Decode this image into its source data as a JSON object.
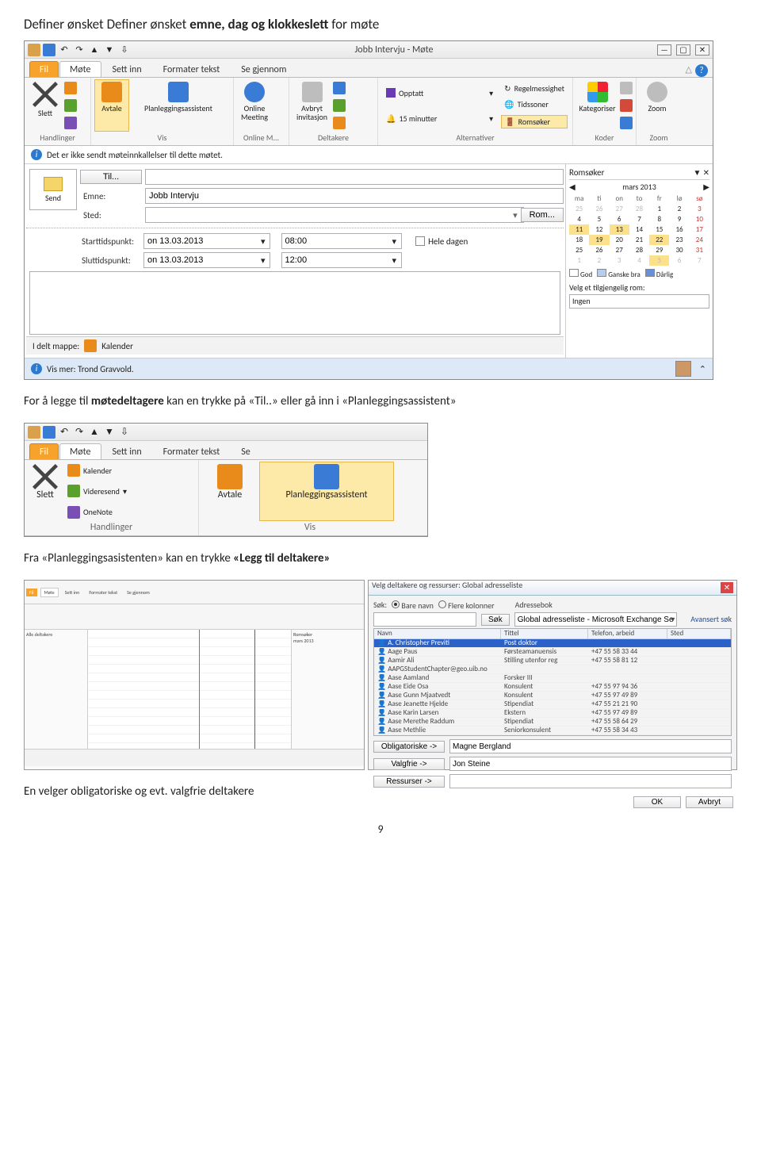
{
  "doc": {
    "heading1": "Definer ønsket emne, dag og klokkeslett for møte",
    "para1": "For å legge til møtedeltagere kan en trykke på «Til..» eller gå inn i «Planleggingsassistent»",
    "para2": "Fra «Planleggingsasistenten» kan en trykke «Legg til deltakere»",
    "para3": "En velger obligatoriske og evt. valgfrie deltakere",
    "page_num": "9"
  },
  "shot1": {
    "title": "Jobb Intervju  -  Møte",
    "tabs": {
      "file": "Fil",
      "mote": "Møte",
      "settinn": "Sett inn",
      "formater": "Formater tekst",
      "segjennom": "Se gjennom"
    },
    "ribbon": {
      "slett": "Slett",
      "handlinger": "Handlinger",
      "avtale": "Avtale",
      "plan": "Planleggingsassistent",
      "vis": "Vis",
      "online1": "Online",
      "online2": "Meeting",
      "online_grp": "Online M...",
      "avbryt1": "Avbryt",
      "avbryt2": "invitasjon",
      "deltakere_grp": "Deltakere",
      "opptatt": "Opptatt",
      "min15": "15 minutter",
      "regel": "Regelmessighet",
      "tidssoner": "Tidssoner",
      "romsoker": "Romsøker",
      "alternativer": "Alternativer",
      "kategoriser": "Kategoriser",
      "koder": "Koder",
      "zoom": "Zoom"
    },
    "infobar": "Det er ikke sendt møteinnkallelser til dette møtet.",
    "form": {
      "send": "Send",
      "til": "Til...",
      "emne_lbl": "Emne:",
      "emne_val": "Jobb Intervju",
      "sted_lbl": "Sted:",
      "sted_val": "",
      "rom_btn": "Rom...",
      "start_lbl": "Starttidspunkt:",
      "slutt_lbl": "Sluttidspunkt:",
      "date": "on 13.03.2013",
      "t_start": "08:00",
      "t_end": "12:00",
      "hele": "Hele dagen"
    },
    "status_folder": {
      "label": "I delt mappe:",
      "value": "Kalender"
    },
    "status_more": "Vis mer: Trond Gravvold.",
    "rs": {
      "title": "Romsøker",
      "month": "mars 2013",
      "dows": [
        "ma",
        "ti",
        "on",
        "to",
        "fr",
        "lø",
        "sø"
      ],
      "rows": [
        [
          "25",
          "26",
          "27",
          "28",
          "1",
          "2",
          "3"
        ],
        [
          "4",
          "5",
          "6",
          "7",
          "8",
          "9",
          "10"
        ],
        [
          "11",
          "12",
          "13",
          "14",
          "15",
          "16",
          "17"
        ],
        [
          "18",
          "19",
          "20",
          "21",
          "22",
          "23",
          "24"
        ],
        [
          "25",
          "26",
          "27",
          "28",
          "29",
          "30",
          "31"
        ],
        [
          "1",
          "2",
          "3",
          "4",
          "5",
          "6",
          "7"
        ]
      ],
      "legend": {
        "god": "God",
        "ganske": "Ganske bra",
        "darlig": "Dårlig"
      },
      "pick": "Velg et tilgjengelig rom:",
      "none": "Ingen"
    }
  },
  "shot2": {
    "tabs": {
      "file": "Fil",
      "mote": "Møte",
      "settinn": "Sett inn",
      "formater": "Formater tekst",
      "se": "Se"
    },
    "items": {
      "slett": "Slett",
      "kalender": "Kalender",
      "videresend": "Videresend",
      "onenote": "OneNote",
      "avtale": "Avtale",
      "plan": "Planleggingsassistent",
      "handlinger": "Handlinger",
      "vis": "Vis"
    }
  },
  "dlg": {
    "title": "Velg deltakere og ressurser: Global adresseliste",
    "search_lbl": "Søk:",
    "r_name": "Bare navn",
    "r_cols": "Flere kolonner",
    "book_lbl": "Adressebok",
    "book_val": "Global adresseliste - Microsoft Exchange Serv",
    "adv": "Avansert søk",
    "go": "Søk",
    "cols": {
      "name": "Navn",
      "title": "Tittel",
      "phone": "Telefon, arbeid",
      "place": "Sted"
    },
    "rows": [
      {
        "name": "A. Christopher Previti",
        "title": "Post doktor",
        "phone": "",
        "sel": true
      },
      {
        "name": "Aage Paus",
        "title": "Førsteamanuensis",
        "phone": "+47 55 58 33 44"
      },
      {
        "name": "Aamir Ali",
        "title": "Stilling utenfor reg",
        "phone": "+47 55 58 81 12"
      },
      {
        "name": "AAPGStudentChapter@geo.uib.no",
        "title": "",
        "phone": ""
      },
      {
        "name": "Aase Aamland",
        "title": "Forsker III",
        "phone": ""
      },
      {
        "name": "Aase Eide Osa",
        "title": "Konsulent",
        "phone": "+47 55 97 94 36"
      },
      {
        "name": "Aase Gunn Mjaatvedt",
        "title": "Konsulent",
        "phone": "+47 55 97 49 89"
      },
      {
        "name": "Aase Jeanette Hjelde",
        "title": "Stipendiat",
        "phone": "+47 55 21 21 90"
      },
      {
        "name": "Aase Karin Larsen",
        "title": "Ekstern",
        "phone": "+47 55 97 49 89"
      },
      {
        "name": "Aase Merethe Raddum",
        "title": "Stipendiat",
        "phone": "+47 55 58 64 29"
      },
      {
        "name": "Aase Methlie",
        "title": "Seniorkonsulent",
        "phone": "+47 55 58 34 43"
      }
    ],
    "oblig": "Obligatoriske ->",
    "oblig_val": "Magne Bergland",
    "valgfri": "Valgfrie ->",
    "valgfri_val": "Jon Steine",
    "res": "Ressurser ->",
    "ok": "OK",
    "cancel": "Avbryt"
  }
}
